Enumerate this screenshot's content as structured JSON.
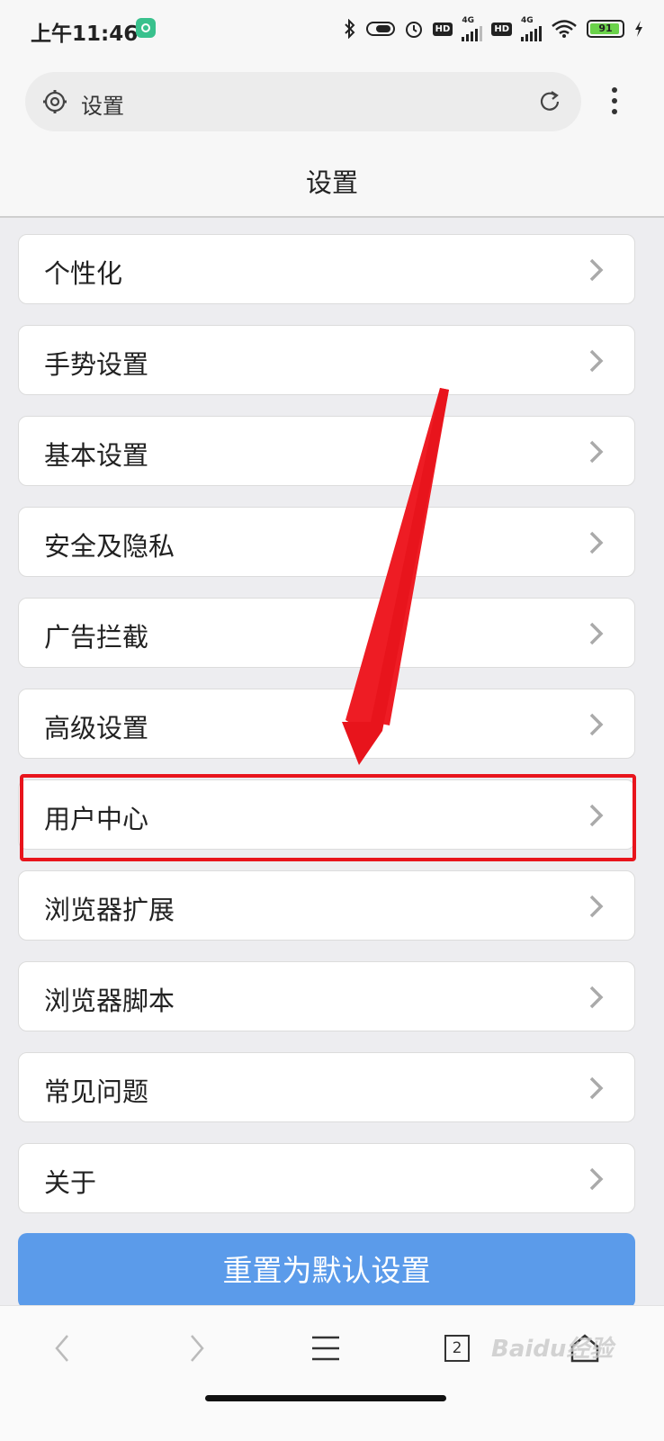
{
  "status_bar": {
    "time": "上午11:46",
    "hd_badge_1": "HD",
    "hd_badge_2": "HD",
    "network_1": "4G",
    "network_2": "4G",
    "battery": "91"
  },
  "browser": {
    "address_text": "设置"
  },
  "header": {
    "title": "设置"
  },
  "settings_items": [
    {
      "label": "个性化"
    },
    {
      "label": "手势设置"
    },
    {
      "label": "基本设置"
    },
    {
      "label": "安全及隐私"
    },
    {
      "label": "广告拦截"
    },
    {
      "label": "高级设置"
    },
    {
      "label": "用户中心"
    },
    {
      "label": "浏览器扩展"
    },
    {
      "label": "浏览器脚本"
    },
    {
      "label": "常见问题"
    },
    {
      "label": "关于"
    }
  ],
  "reset_button": {
    "label": "重置为默认设置"
  },
  "bottom_bar": {
    "tabs_count": "2"
  },
  "watermark": {
    "text": "Baidu经验"
  },
  "colors": {
    "accent_blue": "#5b9bea",
    "highlight_red": "#e8141c",
    "battery_green": "#6ad24a"
  }
}
